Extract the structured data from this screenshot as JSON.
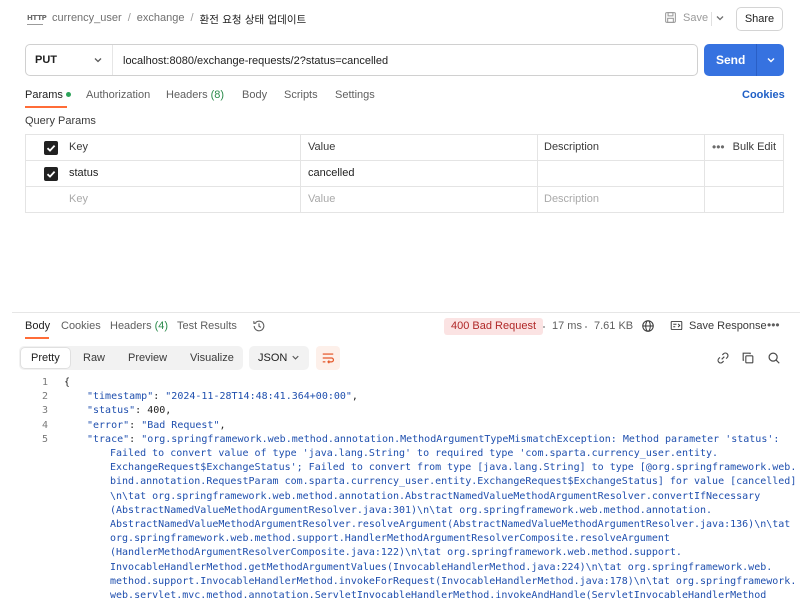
{
  "header": {
    "http_badge": "HTTP",
    "breadcrumbs": [
      "currency_user",
      "exchange",
      "환전 요청 상태 업데이트"
    ],
    "save_label": "Save",
    "share_label": "Share"
  },
  "request": {
    "method": "PUT",
    "url": "localhost:8080/exchange-requests/2?status=cancelled",
    "send_label": "Send"
  },
  "request_tabs": {
    "params": "Params",
    "authorization": "Authorization",
    "headers": "Headers",
    "headers_count": "(8)",
    "body": "Body",
    "scripts": "Scripts",
    "settings": "Settings",
    "cookies": "Cookies"
  },
  "query_params": {
    "title": "Query Params",
    "headers": {
      "key": "Key",
      "value": "Value",
      "description": "Description",
      "bulk_edit": "Bulk Edit",
      "more": "•••"
    },
    "rows": [
      {
        "checked": true,
        "key": "status",
        "value": "cancelled",
        "description": ""
      }
    ],
    "placeholder": {
      "key": "Key",
      "value": "Value",
      "description": "Description"
    }
  },
  "response_tabs": {
    "body": "Body",
    "cookies": "Cookies",
    "headers": "Headers",
    "headers_count": "(4)",
    "test_results": "Test Results"
  },
  "response_meta": {
    "status": "400 Bad Request",
    "time": "17 ms",
    "size": "7.61 KB",
    "save_response": "Save Response",
    "more": "•••"
  },
  "response_toolbar": {
    "formats": [
      "Pretty",
      "Raw",
      "Preview",
      "Visualize"
    ],
    "active_format": "Pretty",
    "language": "JSON"
  },
  "code_lines": [
    {
      "n": "1",
      "parts": [
        [
          "p",
          "{"
        ]
      ]
    },
    {
      "n": "2",
      "parts": [
        [
          "k",
          "\"timestamp\""
        ],
        [
          "p",
          ": "
        ],
        [
          "s",
          "\"2024-11-28T14:48:41.364+00:00\""
        ],
        [
          "p",
          ","
        ]
      ]
    },
    {
      "n": "3",
      "parts": [
        [
          "k",
          "\"status\""
        ],
        [
          "p",
          ": "
        ],
        [
          "n",
          "400"
        ],
        [
          "p",
          ","
        ]
      ]
    },
    {
      "n": "4",
      "parts": [
        [
          "k",
          "\"error\""
        ],
        [
          "p",
          ": "
        ],
        [
          "s",
          "\"Bad Request\""
        ],
        [
          "p",
          ","
        ]
      ]
    },
    {
      "n": "5",
      "parts": [
        [
          "k",
          "\"trace\""
        ],
        [
          "p",
          ": "
        ],
        [
          "s",
          "\"org.springframework.web.method.annotation.MethodArgumentTypeMismatchException: Method parameter 'status':"
        ]
      ]
    },
    {
      "n": "",
      "parts": [
        [
          "s",
          "Failed to convert value of type 'java.lang.String' to required type 'com.sparta.currency_user.entity."
        ]
      ]
    },
    {
      "n": "",
      "parts": [
        [
          "s",
          "ExchangeRequest$ExchangeStatus'; Failed to convert from type [java.lang.String] to type [@org.springframework.web."
        ]
      ]
    },
    {
      "n": "",
      "parts": [
        [
          "s",
          "bind.annotation.RequestParam com.sparta.currency_user.entity.ExchangeRequest$ExchangeStatus] for value [cancelled]"
        ]
      ]
    },
    {
      "n": "",
      "parts": [
        [
          "s",
          "\\n\\tat org.springframework.web.method.annotation.AbstractNamedValueMethodArgumentResolver.convertIfNecessary"
        ]
      ]
    },
    {
      "n": "",
      "parts": [
        [
          "s",
          "(AbstractNamedValueMethodArgumentResolver.java:301)\\n\\tat org.springframework.web.method.annotation."
        ]
      ]
    },
    {
      "n": "",
      "parts": [
        [
          "s",
          "AbstractNamedValueMethodArgumentResolver.resolveArgument(AbstractNamedValueMethodArgumentResolver.java:136)\\n\\tat"
        ]
      ]
    },
    {
      "n": "",
      "parts": [
        [
          "s",
          "org.springframework.web.method.support.HandlerMethodArgumentResolverComposite.resolveArgument"
        ]
      ]
    },
    {
      "n": "",
      "parts": [
        [
          "s",
          "(HandlerMethodArgumentResolverComposite.java:122)\\n\\tat org.springframework.web.method.support."
        ]
      ]
    },
    {
      "n": "",
      "parts": [
        [
          "s",
          "InvocableHandlerMethod.getMethodArgumentValues(InvocableHandlerMethod.java:224)\\n\\tat org.springframework.web."
        ]
      ]
    },
    {
      "n": "",
      "parts": [
        [
          "s",
          "method.support.InvocableHandlerMethod.invokeForRequest(InvocableHandlerMethod.java:178)\\n\\tat org.springframework."
        ]
      ]
    },
    {
      "n": "",
      "parts": [
        [
          "s",
          "web.servlet.mvc.method.annotation.ServletInvocableHandlerMethod.invokeAndHandle(ServletInvocableHandlerMethod"
        ]
      ]
    }
  ]
}
